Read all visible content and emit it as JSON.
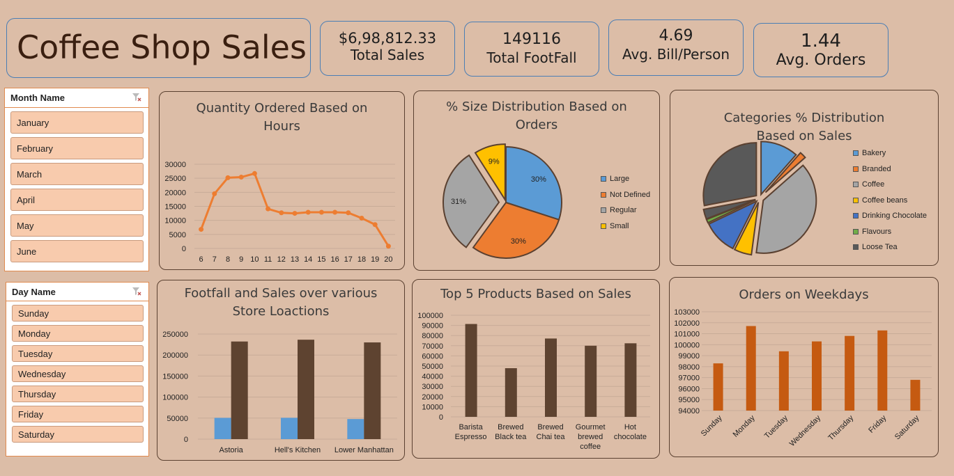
{
  "header": {
    "title": "Coffee Shop Sales",
    "kpis": [
      {
        "value": "$6,98,812.33",
        "label": "Total Sales"
      },
      {
        "value": "149116",
        "label": "Total FootFall"
      },
      {
        "value": "4.69",
        "label": "Avg. Bill/Person"
      },
      {
        "value": "1.44",
        "label": "Avg. Orders"
      }
    ]
  },
  "slicers": {
    "month": {
      "header": "Month Name",
      "items": [
        "January",
        "February",
        "March",
        "April",
        "May",
        "June"
      ]
    },
    "day": {
      "header": "Day Name",
      "items": [
        "Sunday",
        "Monday",
        "Tuesday",
        "Wednesday",
        "Thursday",
        "Friday",
        "Saturday"
      ]
    }
  },
  "colors": {
    "line": "#ed7d31",
    "large": "#5b9bd5",
    "not_defined": "#ed7d31",
    "regular": "#a5a5a5",
    "small": "#ffc000",
    "brown_bar": "#5e4330",
    "blue_bar": "#5b9bd5",
    "orange_bar": "#c55a11",
    "bakery": "#5b9bd5",
    "branded": "#ed7d31",
    "coffee": "#a5a5a5",
    "coffee_beans": "#ffc000",
    "drinking_chocolate": "#4472c4",
    "flavours": "#70ad47",
    "loose_tea": "#595959"
  },
  "chart_data": [
    {
      "type": "line",
      "title": "Quantity Ordered Based on Hours",
      "x": [
        "6",
        "7",
        "8",
        "9",
        "10",
        "11",
        "12",
        "13",
        "14",
        "15",
        "16",
        "17",
        "18",
        "19",
        "20"
      ],
      "values": [
        6800,
        19500,
        25200,
        25400,
        26700,
        14100,
        12700,
        12500,
        12900,
        12900,
        12900,
        12700,
        10800,
        8500,
        800
      ],
      "ylim": [
        0,
        30000
      ],
      "yticks": [
        "0",
        "5000",
        "10000",
        "15000",
        "20000",
        "25000",
        "30000"
      ]
    },
    {
      "type": "pie",
      "title": "% Size Distribution Based on Orders",
      "labels": [
        "Large",
        "Not Defined",
        "Regular",
        "Small"
      ],
      "values": [
        30,
        30,
        31,
        9
      ],
      "data_labels": [
        "30%",
        "30%",
        "31%",
        "9%"
      ]
    },
    {
      "type": "pie",
      "title": "Categories % Distribution Based on Sales",
      "labels": [
        "Bakery",
        "Branded",
        "Coffee",
        "Coffee beans",
        "Drinking Chocolate",
        "Flavours",
        "Loose Tea"
      ],
      "values": [
        11.5,
        2.0,
        38.6,
        5.3,
        10.5,
        1.1,
        3.0,
        28.0
      ]
    },
    {
      "type": "bar",
      "title": "Footfall and Sales over various Store Loactions",
      "categories": [
        "Astoria",
        "Hell's Kitchen",
        "Lower Manhattan"
      ],
      "series": [
        {
          "values": [
            50599,
            50735,
            47782
          ]
        },
        {
          "values": [
            232244,
            236511,
            230057
          ]
        }
      ],
      "ylim": [
        0,
        250000
      ],
      "yticks": [
        "0",
        "50000",
        "100000",
        "150000",
        "200000",
        "250000"
      ]
    },
    {
      "type": "bar",
      "title": "Top 5 Products Based on Sales",
      "categories": [
        [
          "Barista",
          "Espresso"
        ],
        [
          "Brewed",
          "Black tea"
        ],
        [
          "Brewed",
          "Chai tea"
        ],
        [
          "Gourmet",
          "brewed",
          "coffee"
        ],
        [
          "Hot",
          "chocolate"
        ]
      ],
      "values": [
        91400,
        47900,
        77100,
        70000,
        72400
      ],
      "ylim": [
        0,
        100000
      ],
      "yticks": [
        "0",
        "10000",
        "20000",
        "30000",
        "40000",
        "50000",
        "60000",
        "70000",
        "80000",
        "90000",
        "100000"
      ]
    },
    {
      "type": "bar",
      "title": "Orders on Weekdays",
      "categories": [
        "Sunday",
        "Monday",
        "Tuesday",
        "Wednesday",
        "Thursday",
        "Friday",
        "Saturday"
      ],
      "values": [
        98300,
        101700,
        99400,
        100300,
        100800,
        101300,
        96800
      ],
      "ylim": [
        94000,
        103000
      ],
      "yticks": [
        "94000",
        "95000",
        "96000",
        "97000",
        "98000",
        "99000",
        "100000",
        "101000",
        "102000",
        "103000"
      ]
    }
  ]
}
